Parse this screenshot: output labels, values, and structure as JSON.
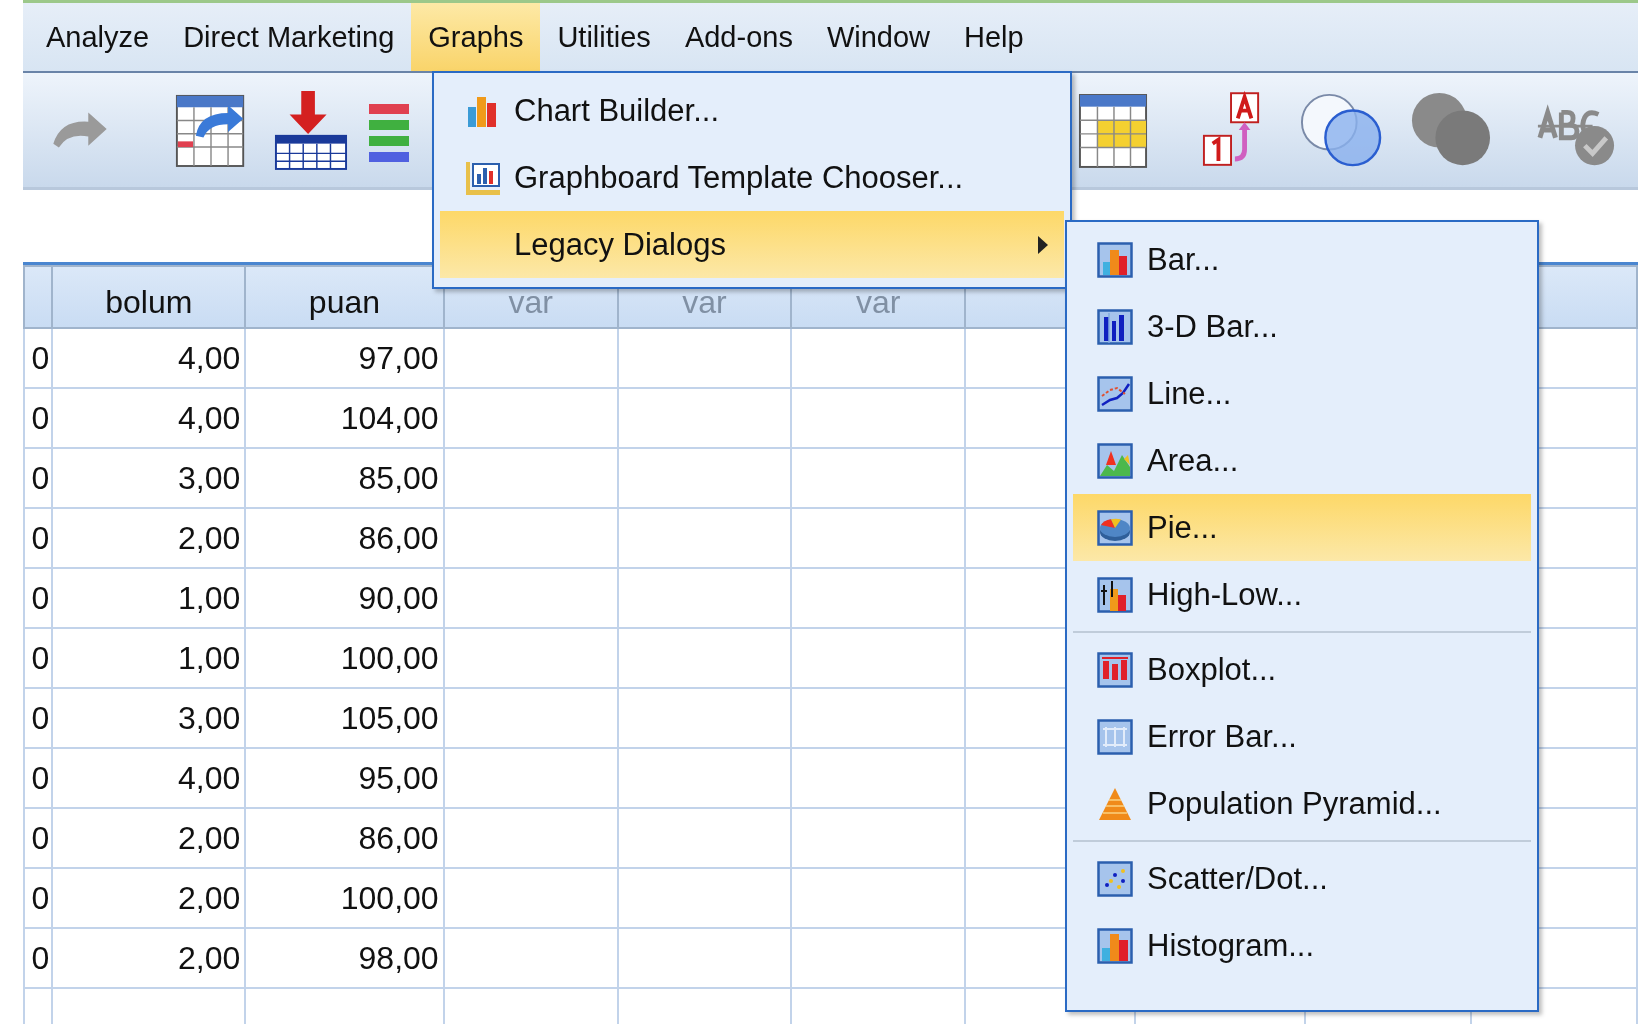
{
  "menu_bar": [
    {
      "label": "Analyze",
      "selected": false
    },
    {
      "label": "Direct Marketing",
      "selected": false
    },
    {
      "label": "Graphs",
      "selected": true
    },
    {
      "label": "Utilities",
      "selected": false
    },
    {
      "label": "Add-ons",
      "selected": false
    },
    {
      "label": "Window",
      "selected": false
    },
    {
      "label": "Help",
      "selected": false
    }
  ],
  "data_grid": {
    "columns": [
      {
        "kind": "row_number"
      },
      {
        "label": "bolum",
        "kind": "variable"
      },
      {
        "label": "puan",
        "kind": "variable"
      },
      {
        "label": "var",
        "kind": "placeholder"
      },
      {
        "label": "var",
        "kind": "placeholder"
      },
      {
        "label": "var",
        "kind": "placeholder"
      }
    ],
    "rows": [
      [
        "0",
        "4,00",
        "97,00"
      ],
      [
        "0",
        "4,00",
        "104,00"
      ],
      [
        "0",
        "3,00",
        "85,00"
      ],
      [
        "0",
        "2,00",
        "86,00"
      ],
      [
        "0",
        "1,00",
        "90,00"
      ],
      [
        "0",
        "1,00",
        "100,00"
      ],
      [
        "0",
        "3,00",
        "105,00"
      ],
      [
        "0",
        "4,00",
        "95,00"
      ],
      [
        "0",
        "2,00",
        "86,00"
      ],
      [
        "0",
        "2,00",
        "100,00"
      ],
      [
        "0",
        "2,00",
        "98,00"
      ]
    ]
  },
  "graphs_menu": {
    "items": [
      {
        "label": "Chart Builder...",
        "selected": false,
        "has_submenu": false
      },
      {
        "label": "Graphboard Template Chooser...",
        "selected": false,
        "has_submenu": false
      },
      {
        "label": "Legacy Dialogs",
        "selected": true,
        "has_submenu": true
      }
    ]
  },
  "legacy_dialogs_menu": {
    "items": [
      {
        "kind": "item",
        "label": "Bar...",
        "selected": false
      },
      {
        "kind": "item",
        "label": "3-D Bar...",
        "selected": false
      },
      {
        "kind": "item",
        "label": "Line...",
        "selected": false
      },
      {
        "kind": "item",
        "label": "Area...",
        "selected": false
      },
      {
        "kind": "item",
        "label": "Pie...",
        "selected": true
      },
      {
        "kind": "item",
        "label": "High-Low...",
        "selected": false
      },
      {
        "kind": "separator"
      },
      {
        "kind": "item",
        "label": "Boxplot...",
        "selected": false
      },
      {
        "kind": "item",
        "label": "Error Bar...",
        "selected": false
      },
      {
        "kind": "item",
        "label": "Population Pyramid...",
        "selected": false
      },
      {
        "kind": "separator"
      },
      {
        "kind": "item",
        "label": "Scatter/Dot...",
        "selected": false
      },
      {
        "kind": "item",
        "label": "Histogram...",
        "selected": false
      }
    ]
  }
}
